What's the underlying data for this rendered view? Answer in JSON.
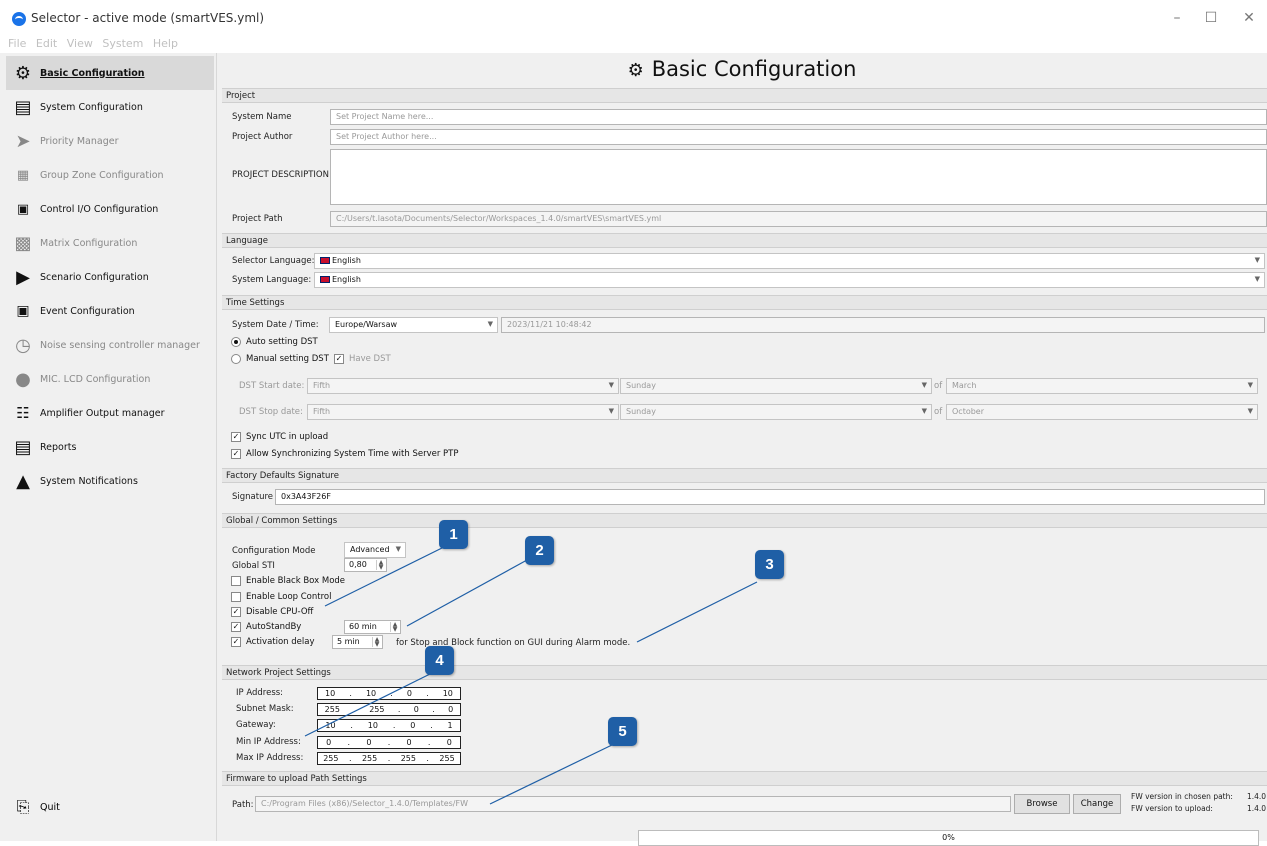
{
  "window": {
    "title": "Selector - active mode (smartVES.yml)"
  },
  "menu": [
    "File",
    "Edit",
    "View",
    "System",
    "Help"
  ],
  "sidebar": {
    "items": [
      {
        "label": "Basic Configuration",
        "icon": "gear-icon"
      },
      {
        "label": "System Configuration",
        "icon": "server-icon"
      },
      {
        "label": "Priority Manager",
        "icon": "priority-arrow-icon"
      },
      {
        "label": "Group Zone Configuration",
        "icon": "zone-grid-icon"
      },
      {
        "label": "Control I/O Configuration",
        "icon": "control-io-icon"
      },
      {
        "label": "Matrix Configuration",
        "icon": "matrix-icon"
      },
      {
        "label": "Scenario Configuration",
        "icon": "scenario-icon"
      },
      {
        "label": "Event Configuration",
        "icon": "event-icon"
      },
      {
        "label": "Noise sensing controller manager",
        "icon": "noise-sensor-icon"
      },
      {
        "label": "MIC. LCD Configuration",
        "icon": "microphone-icon"
      },
      {
        "label": "Amplifier Output manager",
        "icon": "amplifier-icon"
      },
      {
        "label": "Reports",
        "icon": "document-icon"
      },
      {
        "label": "System Notifications",
        "icon": "warning-icon"
      }
    ],
    "quit": "Quit"
  },
  "page": {
    "title": "Basic Configuration"
  },
  "project": {
    "section": "Project",
    "system_name_label": "System Name",
    "system_name_placeholder": "Set Project Name here...",
    "author_label": "Project Author",
    "author_placeholder": "Set Project Author here...",
    "description_label": "PROJECT DESCRIPTION",
    "path_label": "Project Path",
    "path_value": "C:/Users/t.lasota/Documents/Selector/Workspaces_1.4.0/smartVES\\smartVES.yml"
  },
  "language": {
    "section": "Language",
    "selector_label": "Selector Language:",
    "selector_value": "English",
    "system_label": "System Language:",
    "system_value": "English"
  },
  "time": {
    "section": "Time Settings",
    "date_label": "System Date / Time:",
    "timezone": "Europe/Warsaw",
    "datetime": "2023/11/21 10:48:42",
    "auto_dst": "Auto setting DST",
    "manual_dst": "Manual setting DST",
    "have_dst": "Have DST",
    "dst_start_label": "DST Start date:",
    "dst_stop_label": "DST Stop date:",
    "start": {
      "week": "Fifth",
      "day": "Sunday",
      "of": "of",
      "month": "March"
    },
    "stop": {
      "week": "Fifth",
      "day": "Sunday",
      "of": "of",
      "month": "October"
    },
    "sync_utc": "Sync UTC in upload",
    "allow_ptp": "Allow Synchronizing System Time with Server PTP"
  },
  "factory": {
    "section": "Factory Defaults Signature",
    "signature_label": "Signature",
    "signature_value": "0x3A43F26F"
  },
  "global": {
    "section": "Global / Common Settings",
    "config_mode_label": "Configuration Mode",
    "config_mode_value": "Advanced",
    "sti_label": "Global STI",
    "sti_value": "0,80",
    "black_box": "Enable Black Box Mode",
    "loop_control": "Enable Loop Control",
    "disable_cpu_off": "Disable CPU-Off",
    "autostandby": "AutoStandBy",
    "autostandby_value": "60 min",
    "activation_delay": "Activation delay",
    "activation_value": "5 min",
    "activation_note": "for Stop and Block function on GUI during Alarm mode."
  },
  "network": {
    "section": "Network Project Settings",
    "rows": [
      {
        "label": "IP Address:",
        "octets": [
          "10",
          "10",
          "0",
          "10"
        ]
      },
      {
        "label": "Subnet Mask:",
        "octets": [
          "255",
          "255",
          "0",
          "0"
        ]
      },
      {
        "label": "Gateway:",
        "octets": [
          "10",
          "10",
          "0",
          "1"
        ]
      },
      {
        "label": "Min IP Address:",
        "octets": [
          "0",
          "0",
          "0",
          "0"
        ]
      },
      {
        "label": "Max IP Address:",
        "octets": [
          "255",
          "255",
          "255",
          "255"
        ]
      }
    ]
  },
  "firmware": {
    "section": "Firmware to upload Path Settings",
    "path_label": "Path:",
    "path_value": "C:/Program Files (x86)/Selector_1.4.0/Templates/FW",
    "browse": "Browse",
    "change": "Change",
    "fw_chosen_label": "FW version in chosen path:",
    "fw_chosen_value": "1.4.0",
    "fw_upload_label": "FW version to upload:",
    "fw_upload_value": "1.4.0"
  },
  "progress": {
    "text": "0%"
  },
  "callouts": [
    "1",
    "2",
    "3",
    "4",
    "5"
  ],
  "colors": {
    "callout": "#1f5fa6",
    "callout_line": "#1f5fa6"
  }
}
